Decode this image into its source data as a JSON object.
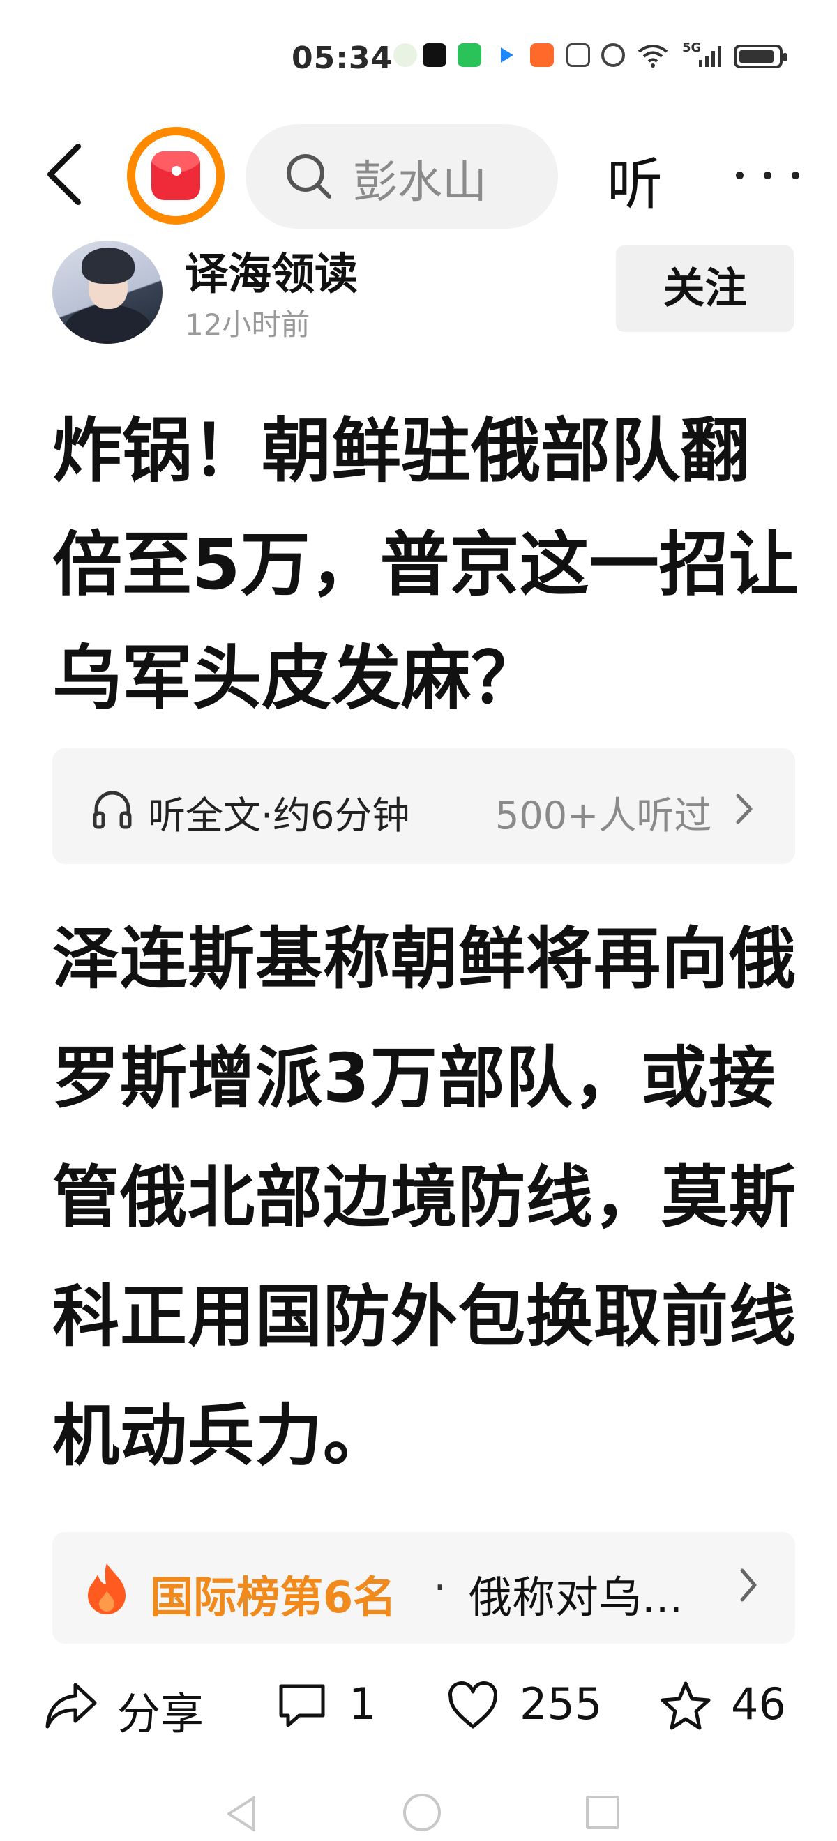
{
  "status_bar": {
    "time": "05:34",
    "network": "5G",
    "icons": [
      "app-icon-1",
      "tiktok-icon",
      "app-icon-3",
      "arrow-icon",
      "app-icon-5",
      "nfc-icon",
      "alarm-icon",
      "wifi-icon",
      "signal-icon",
      "battery-icon"
    ],
    "battery_level_percent": 90
  },
  "header": {
    "search_query": "彭水山",
    "listen_label": "听",
    "brand_colors": {
      "ring": "#ff8a00",
      "logo": "#ef2b3a"
    }
  },
  "author": {
    "name": "译海领读",
    "time": "12小时前",
    "follow_label": "关注"
  },
  "article": {
    "title": "炸锅！朝鲜驻俄部队翻倍至5万，普京这一招让乌军头皮发麻？",
    "listen_bar": {
      "label": "听全文·约6分钟",
      "count": "500+人听过"
    },
    "body": "泽连斯基称朝鲜将再向俄罗斯增派3万部队，或接管俄北部边境防线，莫斯科正用国防外包换取前线机动兵力。"
  },
  "hot": {
    "rank": "国际榜第6名",
    "separator": "·",
    "topic": "俄称对乌...",
    "rank_color": "#f08a1c"
  },
  "actions": {
    "share_label": "分享",
    "comment_count": "1",
    "like_count": "255",
    "favorite_count": "46"
  }
}
